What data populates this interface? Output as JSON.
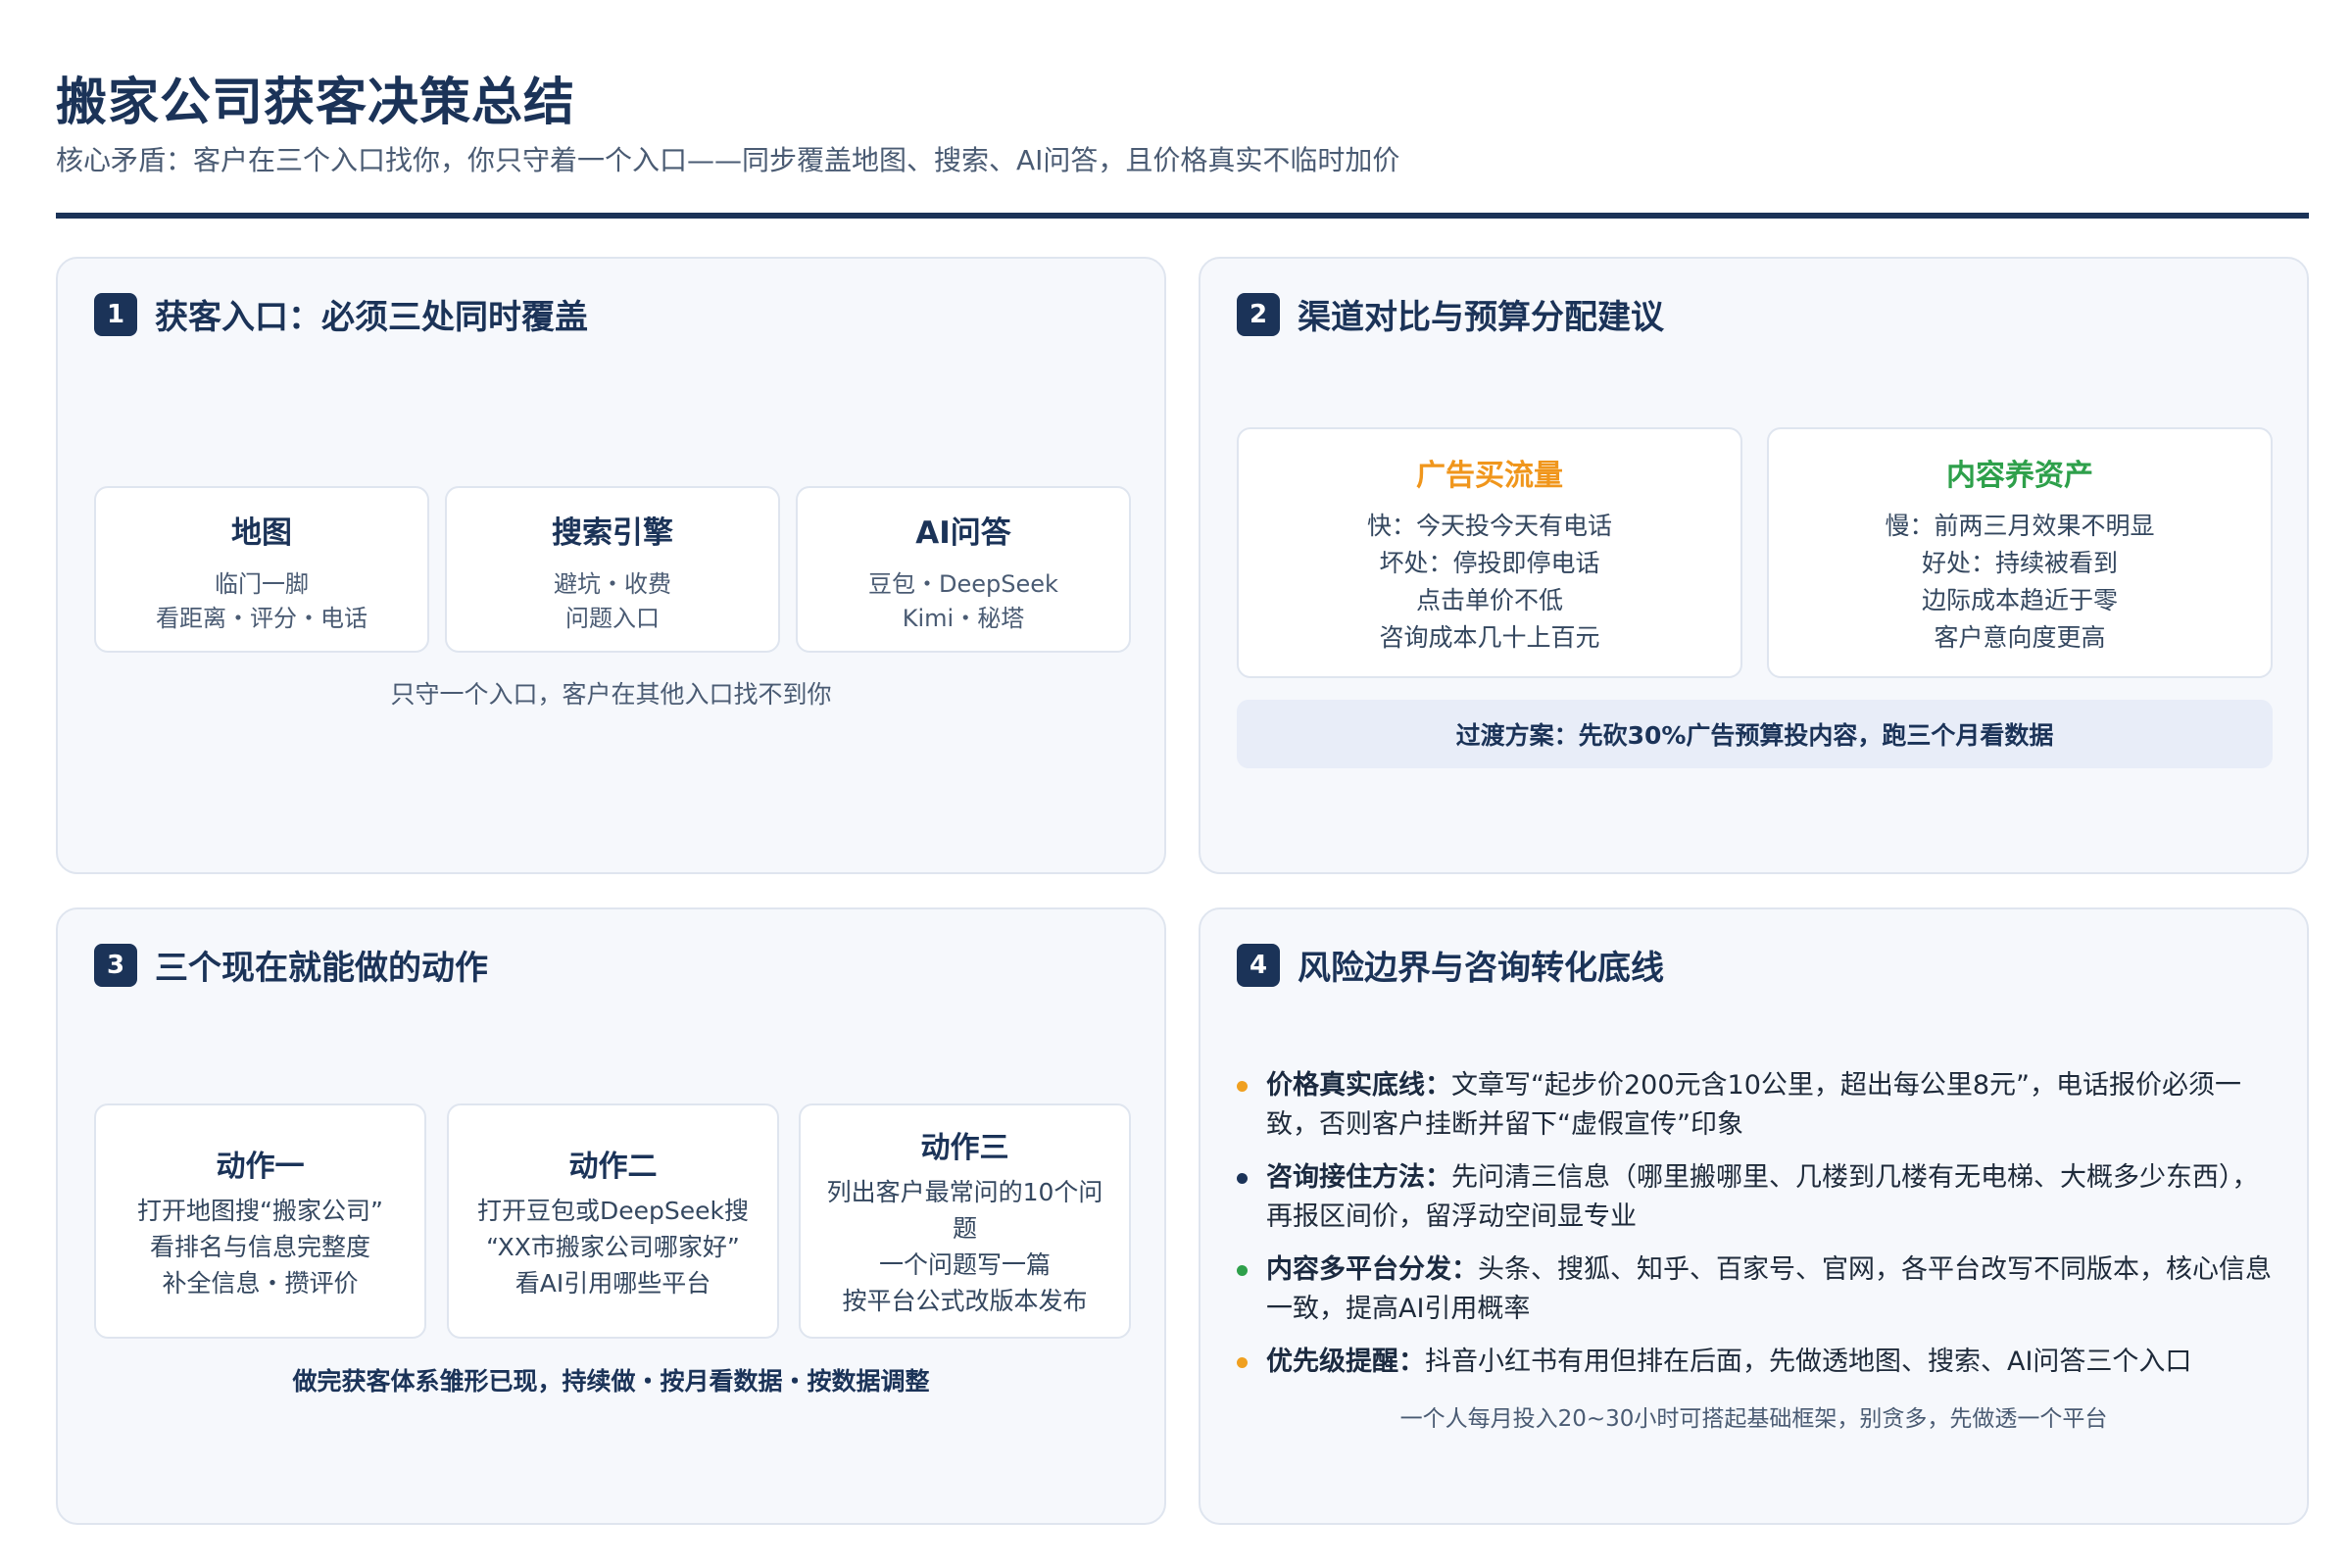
{
  "header": {
    "title": "搬家公司获客决策总结",
    "subtitle": "核心矛盾：客户在三个入口找你，你只守着一个入口——同步覆盖地图、搜索、AI问答，且价格真实不临时加价"
  },
  "panel1": {
    "num": "1",
    "title": "获客入口：必须三处同时覆盖",
    "cards": [
      {
        "title": "地图",
        "line1": "临门一脚",
        "line2": "看距离・评分・电话"
      },
      {
        "title": "搜索引擎",
        "line1": "避坑・收费",
        "line2": "问题入口"
      },
      {
        "title": "AI问答",
        "line1": "豆包・DeepSeek",
        "line2": "Kimi・秘塔"
      }
    ],
    "note": "只守一个入口，客户在其他入口找不到你"
  },
  "panel2": {
    "num": "2",
    "title": "渠道对比与预算分配建议",
    "cards": [
      {
        "title": "广告买流量",
        "color": "#f0961c",
        "lines": [
          "快：今天投今天有电话",
          "坏处：停投即停电话",
          "点击单价不低",
          "咨询成本几十上百元"
        ]
      },
      {
        "title": "内容养资产",
        "color": "#2ea04b",
        "lines": [
          "慢：前两三月效果不明显",
          "好处：持续被看到",
          "边际成本趋近于零",
          "客户意向度更高"
        ]
      }
    ],
    "strip": "过渡方案：先砍30%广告预算投内容，跑三个月看数据"
  },
  "panel3": {
    "num": "3",
    "title": "三个现在就能做的动作",
    "cards": [
      {
        "title": "动作一",
        "lines": [
          "打开地图搜“搬家公司”",
          "看排名与信息完整度",
          "补全信息・攒评价"
        ]
      },
      {
        "title": "动作二",
        "lines": [
          "打开豆包或DeepSeek搜",
          "“XX市搬家公司哪家好”",
          "看AI引用哪些平台"
        ]
      },
      {
        "title": "动作三",
        "lines": [
          "列出客户最常问的10个问题",
          "一个问题写一篇",
          "按平台公式改版本发布"
        ]
      }
    ],
    "note": "做完获客体系雏形已现，持续做・按月看数据・按数据调整"
  },
  "panel4": {
    "num": "4",
    "title": "风险边界与咨询转化底线",
    "bullets": [
      {
        "label": "价格真实底线：",
        "text": "文章写“起步价200元含10公里，超出每公里8元”，电话报价必须一致，否则客户挂断并留下“虚假宣传”印象",
        "color": "#f0a020"
      },
      {
        "label": "咨询接住方法：",
        "text": "先问清三信息（哪里搬哪里、几楼到几楼有无电梯、大概多少东西），再报区间价，留浮动空间显专业",
        "color": "#1b3358"
      },
      {
        "label": "内容多平台分发：",
        "text": "头条、搜狐、知乎、百家号、官网，各平台改写不同版本，核心信息一致，提高AI引用概率",
        "color": "#2ea04b"
      },
      {
        "label": "优先级提醒：",
        "text": "抖音小红书有用但排在后面，先做透地图、搜索、AI问答三个入口",
        "color": "#f0a020"
      }
    ],
    "note": "一个人每月投入20~30小时可搭起基础框架，别贪多，先做透一个平台"
  }
}
